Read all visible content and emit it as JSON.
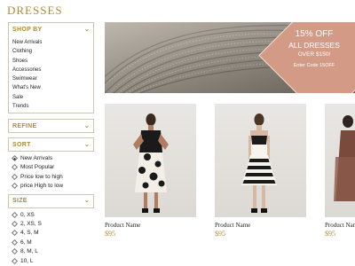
{
  "page_title": "DRESSES",
  "sidebar": {
    "shop_by": {
      "label": "SHOP BY",
      "items": [
        "New Arrivals",
        "Clothing",
        "Shoes",
        "Accessories",
        "Swimwear",
        "What's New",
        "Sale",
        "Trends"
      ]
    },
    "refine": {
      "label": "REFINE"
    },
    "sort": {
      "label": "SORT",
      "options": [
        "New Arrivals",
        "Most Popular",
        "Price low to high",
        "price High to low"
      ],
      "selected_index": 0
    },
    "size": {
      "label": "SIZE",
      "options": [
        "0, XS",
        "2, XS, S",
        "4, S, M",
        "6, M",
        "8, M, L",
        "10, L"
      ]
    }
  },
  "banner": {
    "headline": "15% OFF",
    "subline": "ALL DRESSES",
    "condition": "OVER $150!",
    "code_text": "Enter Code 15OFF",
    "accent_color": "#d39a86"
  },
  "products": [
    {
      "name": "Product Name",
      "price": "$95"
    },
    {
      "name": "Product Name",
      "price": "$95"
    },
    {
      "name": "Product Name",
      "price": "$95"
    }
  ],
  "colors": {
    "brand": "#b08a3a",
    "panel_border": "#cfc6b0"
  }
}
